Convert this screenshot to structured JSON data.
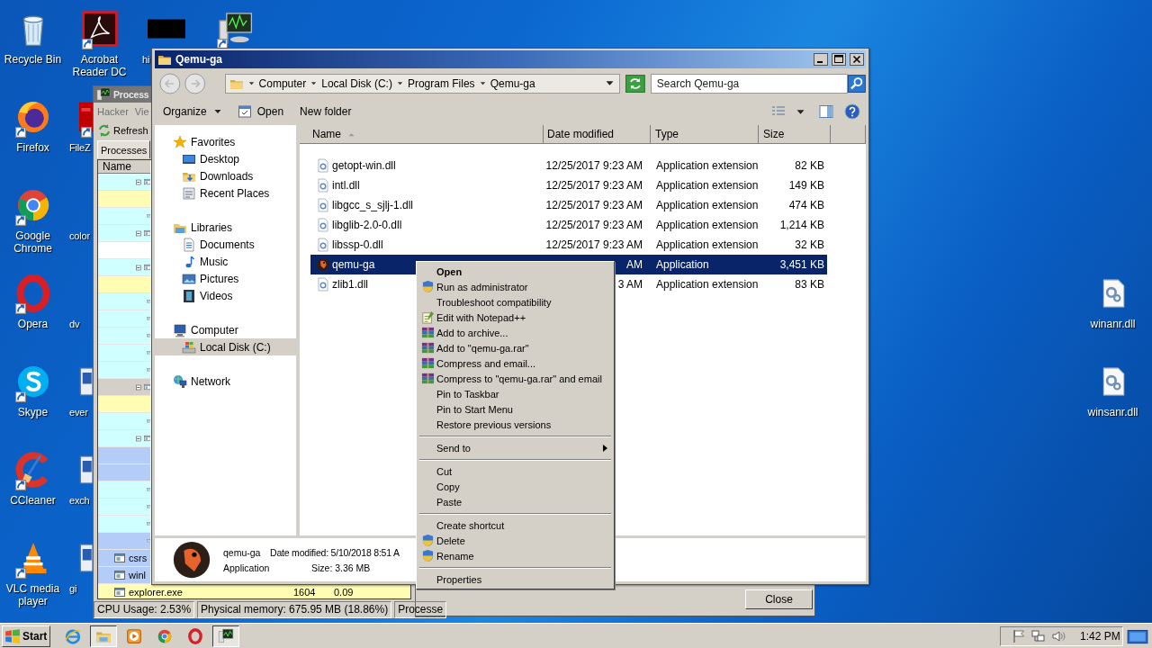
{
  "desktop": {
    "columns": [
      {
        "icons": [
          {
            "label": "Recycle Bin",
            "kind": "recycle",
            "shortcut": false
          },
          {
            "label": "Firefox",
            "kind": "firefox",
            "shortcut": true
          },
          {
            "label": "Google Chrome",
            "kind": "chrome",
            "shortcut": true
          },
          {
            "label": "Opera",
            "kind": "opera",
            "shortcut": true
          },
          {
            "label": "Skype",
            "kind": "skype",
            "shortcut": true
          },
          {
            "label": "CCleaner",
            "kind": "ccleaner",
            "shortcut": true
          },
          {
            "label": "VLC media player",
            "kind": "vlc",
            "shortcut": true
          }
        ]
      },
      {
        "icons": [
          {
            "label": "Acrobat Reader DC",
            "kind": "acrobat",
            "shortcut": true
          },
          {
            "label": "FileZ",
            "kind": "filezilla",
            "shortcut": true
          },
          {
            "label": "color"
          },
          {
            "label": "dv"
          },
          {
            "label": "ever",
            "kind": "doc",
            "shortcut": false
          },
          {
            "label": "exch",
            "kind": "doc",
            "shortcut": false
          },
          {
            "label": "gi",
            "kind": "doc",
            "shortcut": false
          }
        ]
      },
      {
        "icons": [
          {
            "label": "hi",
            "kind": "black",
            "shortcut": false
          }
        ]
      },
      {
        "icons": [
          {
            "kind": "monitor",
            "shortcut": true
          }
        ]
      }
    ],
    "right_icons": [
      {
        "label": "winanr.dll",
        "kind": "dll",
        "shortcut": false
      },
      {
        "label": "winsanr.dll",
        "kind": "dll",
        "shortcut": false
      }
    ]
  },
  "dialog": {
    "button": "Close"
  },
  "process_hacker": {
    "title": "Process",
    "menu": [
      "Hacker",
      "Vie"
    ],
    "refresh": "Refresh",
    "tabs": [
      {
        "label": "Processes",
        "selected": true
      }
    ],
    "column": "Name",
    "rows": [
      {
        "kind": "group",
        "color": "#d0ffff"
      },
      {
        "kind": "plain",
        "color": "#fffcb4"
      },
      {
        "kind": "item",
        "color": "#d0ffff"
      },
      {
        "kind": "group",
        "color": "#d0ffff"
      },
      {
        "kind": "plain",
        "color": "#ffffff"
      },
      {
        "kind": "group",
        "color": "#d0ffff"
      },
      {
        "kind": "plain",
        "color": "#fffcb4"
      },
      {
        "kind": "item",
        "color": "#d0ffff"
      },
      {
        "kind": "item",
        "color": "#d0ffff"
      },
      {
        "kind": "item",
        "color": "#d0ffff"
      },
      {
        "kind": "item",
        "color": "#d0ffff"
      },
      {
        "kind": "item",
        "color": "#d0ffff"
      },
      {
        "kind": "group",
        "color": "#d4d0c8"
      },
      {
        "kind": "plain",
        "color": "#fffcb4"
      },
      {
        "kind": "item",
        "color": "#d0ffff"
      },
      {
        "kind": "group",
        "color": "#d0ffff"
      },
      {
        "kind": "plain",
        "color": "#b4ccf8"
      },
      {
        "kind": "plain",
        "color": "#b4ccf8"
      },
      {
        "kind": "item",
        "color": "#d0ffff"
      },
      {
        "kind": "item",
        "color": "#d0ffff"
      },
      {
        "kind": "item",
        "color": "#d0ffff"
      },
      {
        "kind": "item",
        "color": "#b4ccf8"
      },
      {
        "kind": "named",
        "color": "#b4ccf8",
        "name": "csrs"
      },
      {
        "kind": "named",
        "color": "#b4ccf8",
        "name": "winl"
      },
      {
        "kind": "named",
        "color": "#fffcb4",
        "name": "explorer.exe",
        "pid": "1604",
        "cpu": "0.09"
      }
    ],
    "status": [
      "CPU Usage: 2.53%",
      "Physical memory: 675.95 MB (18.86%)",
      "Processe"
    ]
  },
  "explorer": {
    "title": "Qemu-ga",
    "address": [
      "Computer",
      "Local Disk (C:)",
      "Program Files",
      "Qemu-ga"
    ],
    "search": {
      "placeholder": "Search Qemu-ga"
    },
    "toolbar": [
      {
        "label": "Organize",
        "kind": "menu"
      },
      {
        "label": "Open",
        "kind": "open"
      },
      {
        "label": "New folder",
        "kind": "plain"
      }
    ],
    "nav": [
      {
        "label": "Favorites",
        "kind": "favorites",
        "selected": false,
        "children": [
          {
            "label": "Desktop",
            "kind": "desktop",
            "selected": false
          },
          {
            "label": "Downloads",
            "kind": "downloads",
            "selected": false
          },
          {
            "label": "Recent Places",
            "kind": "recent",
            "selected": false
          }
        ]
      },
      {
        "label": "Libraries",
        "kind": "libraries",
        "selected": false,
        "children": [
          {
            "label": "Documents",
            "kind": "documents",
            "selected": false
          },
          {
            "label": "Music",
            "kind": "music",
            "selected": false
          },
          {
            "label": "Pictures",
            "kind": "pictures",
            "selected": false
          },
          {
            "label": "Videos",
            "kind": "videos",
            "selected": false
          }
        ]
      },
      {
        "label": "Computer",
        "kind": "computer",
        "selected": false,
        "children": [
          {
            "label": "Local Disk (C:)",
            "kind": "disk",
            "selected": true
          }
        ]
      },
      {
        "label": "Network",
        "kind": "network",
        "selected": false
      }
    ],
    "columns": [
      {
        "label": "Name",
        "sorted": true
      },
      {
        "label": "Date modified",
        "sorted": false
      },
      {
        "label": "Type",
        "sorted": false
      },
      {
        "label": "Size",
        "sorted": false
      }
    ],
    "files": [
      {
        "name": "getopt-win.dll",
        "kind": "dll",
        "date": "12/25/2017 9:23 AM",
        "type": "Application extension",
        "size": "82 KB",
        "selected": false
      },
      {
        "name": "intl.dll",
        "kind": "dll",
        "date": "12/25/2017 9:23 AM",
        "type": "Application extension",
        "size": "149 KB",
        "selected": false
      },
      {
        "name": "libgcc_s_sjlj-1.dll",
        "kind": "dll",
        "date": "12/25/2017 9:23 AM",
        "type": "Application extension",
        "size": "474 KB",
        "selected": false
      },
      {
        "name": "libglib-2.0-0.dll",
        "kind": "dll",
        "date": "12/25/2017 9:23 AM",
        "type": "Application extension",
        "size": "1,214 KB",
        "selected": false
      },
      {
        "name": "libssp-0.dll",
        "kind": "dll",
        "date": "12/25/2017 9:23 AM",
        "type": "Application extension",
        "size": "32 KB",
        "selected": false
      },
      {
        "name": "qemu-ga",
        "kind": "app",
        "date": "AM",
        "type": "Application",
        "size": "3,451 KB",
        "selected": true
      },
      {
        "name": "zlib1.dll",
        "kind": "dll",
        "date": "3 AM",
        "type": "Application extension",
        "size": "83 KB",
        "selected": false
      }
    ],
    "details": {
      "name": "qemu-ga",
      "date": "Date modified: 5/10/2018 8:51 A",
      "type": "Application",
      "size": "Size: 3.36 MB"
    }
  },
  "context_menu": {
    "items": [
      {
        "label": "Open",
        "kind": "default"
      },
      {
        "label": "Run as administrator",
        "kind": "shield"
      },
      {
        "label": "Troubleshoot compatibility",
        "kind": "plain"
      },
      {
        "label": "Edit with Notepad++",
        "kind": "notepad"
      },
      {
        "label": "Add to archive...",
        "kind": "archive"
      },
      {
        "label": "Add to \"qemu-ga.rar\"",
        "kind": "archive"
      },
      {
        "label": "Compress and email...",
        "kind": "archive"
      },
      {
        "label": "Compress to \"qemu-ga.rar\" and email",
        "kind": "archive"
      },
      {
        "label": "Pin to Taskbar",
        "kind": "plain"
      },
      {
        "label": "Pin to Start Menu",
        "kind": "plain"
      },
      {
        "label": "Restore previous versions",
        "kind": "plain"
      },
      {
        "kind": "separator"
      },
      {
        "label": "Send to",
        "kind": "submenu"
      },
      {
        "kind": "separator"
      },
      {
        "label": "Cut",
        "kind": "plain"
      },
      {
        "label": "Copy",
        "kind": "plain"
      },
      {
        "label": "Paste",
        "kind": "plain"
      },
      {
        "kind": "separator"
      },
      {
        "label": "Create shortcut",
        "kind": "plain"
      },
      {
        "label": "Delete",
        "kind": "shield"
      },
      {
        "label": "Rename",
        "kind": "shield"
      },
      {
        "kind": "separator"
      },
      {
        "label": "Properties",
        "kind": "plain"
      }
    ]
  },
  "taskbar": {
    "start": "Start",
    "apps": [
      {
        "kind": "ie",
        "open": false
      },
      {
        "kind": "explorer",
        "open": true
      },
      {
        "kind": "media",
        "open": false
      },
      {
        "kind": "chrome",
        "open": false
      },
      {
        "kind": "opera",
        "open": false
      },
      {
        "kind": "processhacker",
        "open": true
      }
    ],
    "clock": "1:42 PM"
  }
}
